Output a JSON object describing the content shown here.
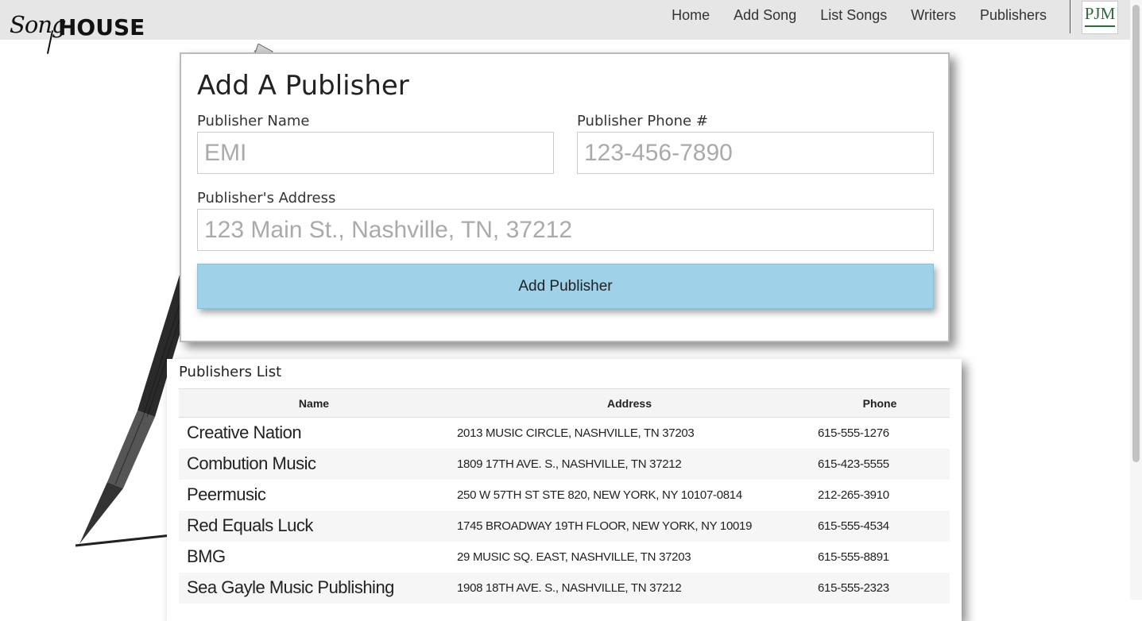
{
  "brand": {
    "part1": "Song",
    "part2": "HOUSE"
  },
  "nav": {
    "items": [
      "Home",
      "Add Song",
      "List Songs",
      "Writers",
      "Publishers"
    ],
    "badge": "PJM"
  },
  "form": {
    "title": "Add A Publisher",
    "name_label": "Publisher Name",
    "name_placeholder": "EMI",
    "phone_label": "Publisher Phone #",
    "phone_placeholder": "123-456-7890",
    "address_label": "Publisher's Address",
    "address_placeholder": "123 Main St., Nashville, TN, 37212",
    "submit_label": "Add Publisher"
  },
  "list": {
    "title": "Publishers List",
    "columns": [
      "Name",
      "Address",
      "Phone"
    ],
    "rows": [
      {
        "name": "Creative Nation",
        "address": "2013 MUSIC CIRCLE, NASHVILLE, TN 37203",
        "phone": "615-555-1276"
      },
      {
        "name": "Combution Music",
        "address": "1809 17TH AVE. S., NASHVILLE, TN 37212",
        "phone": "615-423-5555"
      },
      {
        "name": "Peermusic",
        "address": "250 W 57TH ST STE 820, NEW YORK, NY 10107-0814",
        "phone": "212-265-3910"
      },
      {
        "name": "Red Equals Luck",
        "address": "1745 BROADWAY 19TH FLOOR, NEW YORK, NY 10019",
        "phone": "615-555-4534"
      },
      {
        "name": "BMG",
        "address": "29 MUSIC SQ. EAST, NASHVILLE, TN 37203",
        "phone": "615-555-8891"
      },
      {
        "name": "Sea Gayle Music Publishing",
        "address": "1908 18TH AVE. S., NASHVILLE, TN 37212",
        "phone": "615-555-2323"
      }
    ]
  }
}
